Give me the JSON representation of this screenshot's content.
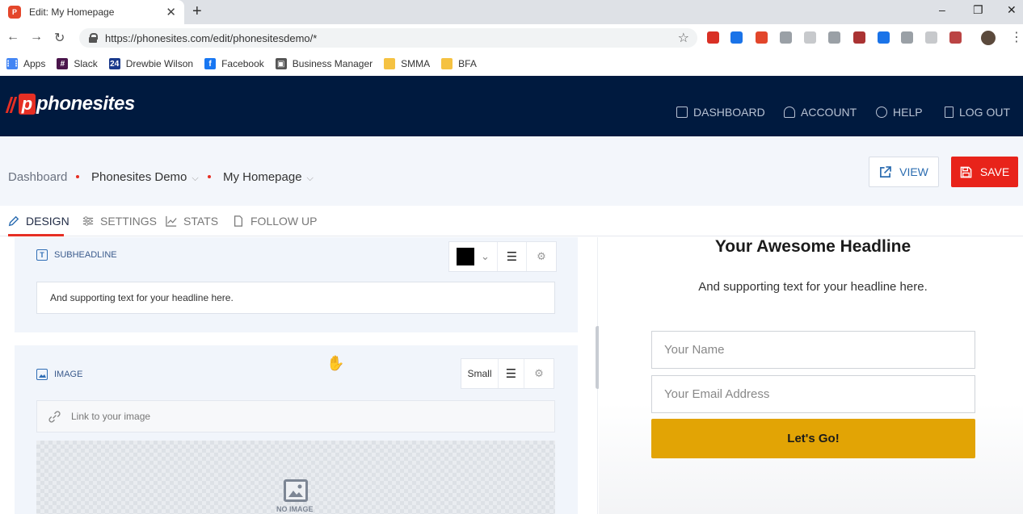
{
  "browser": {
    "tab_title": "Edit: My Homepage",
    "tab_favicon_text": "P",
    "close_glyph": "✕",
    "new_tab_glyph": "+",
    "window_controls": [
      "–",
      "❐",
      "✕"
    ],
    "back_glyph": "←",
    "forward_glyph": "→",
    "reload_glyph": "↻",
    "url": "https://phonesites.com/edit/phonesitesdemo/*",
    "star_glyph": "☆",
    "menu_glyph": "⋮",
    "extensions": [
      {
        "name": "extension-red-icon",
        "color": "#d93025"
      },
      {
        "name": "extension-code-icon",
        "color": "#1a73e8"
      },
      {
        "name": "extension-swirl-icon",
        "color": "#e2462b"
      },
      {
        "name": "extension-facebook-icon",
        "color": "#9aa0a6"
      },
      {
        "name": "extension-dots-icon",
        "color": "#c7c9cc"
      },
      {
        "name": "extension-fb-icon",
        "color": "#9aa0a6"
      },
      {
        "name": "extension-shield-icon",
        "color": "#a33"
      },
      {
        "name": "extension-blue-icon",
        "color": "#1a73e8"
      },
      {
        "name": "extension-toggle-icon",
        "color": "#9aa0a6"
      },
      {
        "name": "extension-doc-icon",
        "color": "#c7c9cc"
      },
      {
        "name": "extension-pdf-icon",
        "color": "#b44"
      }
    ],
    "bookmarks": [
      {
        "label": "Apps",
        "icon": "apps-grid-icon",
        "color": "#4285f4",
        "glyph": "⋮⋮"
      },
      {
        "label": "Slack",
        "icon": "slack-icon",
        "color": "#4a154b",
        "glyph": "#"
      },
      {
        "label": "Drewbie Wilson",
        "icon": "24-icon",
        "color": "#1a3a8c",
        "glyph": "24"
      },
      {
        "label": "Facebook",
        "icon": "facebook-icon",
        "color": "#1877f2",
        "glyph": "f"
      },
      {
        "label": "Business Manager",
        "icon": "business-manager-icon",
        "color": "#555",
        "glyph": "▣"
      },
      {
        "label": "SMMA",
        "icon": "folder-icon",
        "color": "#f5c242",
        "glyph": ""
      },
      {
        "label": "BFA",
        "icon": "folder-icon",
        "color": "#f5c242",
        "glyph": ""
      }
    ]
  },
  "app": {
    "logo_text": "phonesites",
    "logo_p": "p",
    "nav": {
      "dashboard": "DASHBOARD",
      "account": "ACCOUNT",
      "help": "HELP",
      "logout": "LOG OUT"
    },
    "breadcrumb": {
      "root": "Dashboard",
      "site": "Phonesites Demo",
      "page": "My Homepage",
      "chevron": "⌵"
    },
    "actions": {
      "view": "VIEW",
      "save": "SAVE"
    },
    "tabs": {
      "design": "DESIGN",
      "settings": "SETTINGS",
      "stats": "STATS",
      "followup": "FOLLOW UP"
    },
    "colors": {
      "header_bg": "#001a3f",
      "brand_red": "#e62f24",
      "cta_yellow": "#e2a405",
      "text_color_swatch": "#000000"
    }
  },
  "editor": {
    "subheadline": {
      "label": "SUBHEADLINE",
      "icon_letter": "T",
      "value": "And supporting text for your headline here."
    },
    "image": {
      "label": "IMAGE",
      "size_option": "Small",
      "link_placeholder": "Link to your image",
      "no_image_label": "NO IMAGE"
    },
    "glyphs": {
      "chevron_down": "⌄",
      "align_center": "☰",
      "settings": "⚙",
      "link": "🔗",
      "hand": "✋"
    }
  },
  "preview": {
    "headline": "Your Awesome Headline",
    "subheadline": "And supporting text for your headline here.",
    "name_placeholder": "Your Name",
    "email_placeholder": "Your Email Address",
    "cta": "Let's Go!"
  }
}
